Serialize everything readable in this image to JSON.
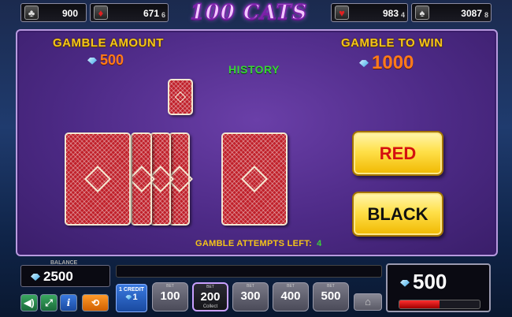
{
  "jackpots": [
    {
      "suit": "clubs",
      "symbol": "♣",
      "value": "900",
      "sub": ""
    },
    {
      "suit": "diamonds",
      "symbol": "♦",
      "value": "671",
      "sub": "6"
    },
    {
      "suit": "hearts",
      "symbol": "♥",
      "value": "983",
      "sub": "4"
    },
    {
      "suit": "spades",
      "symbol": "♠",
      "value": "3087",
      "sub": "8"
    }
  ],
  "logo": "100 CATS",
  "gamble": {
    "amount_label": "GAMBLE AMOUNT",
    "amount_value": "500",
    "to_win_label": "GAMBLE TO WIN",
    "to_win_value": "1000",
    "history_label": "HISTORY",
    "red_label": "RED",
    "black_label": "BLACK",
    "attempts_label": "GAMBLE ATTEMPTS LEFT:",
    "attempts_value": "4"
  },
  "bottom": {
    "balance_label": "BALANCE",
    "balance_value": "2500",
    "credit_label": "1 CREDIT",
    "credit_value": "1",
    "bet_label": "BET",
    "bets": [
      "100",
      "200",
      "300",
      "400",
      "500"
    ],
    "selected_bet": "200",
    "collect_label": "Collect",
    "win_value": "500",
    "win_meter_fraction": 0.5
  },
  "colors": {
    "accent_gold": "#f5c518",
    "amount_orange": "#ff7a1a",
    "history_green": "#3ad03a",
    "panel_purple": "#4d2a86",
    "card_red": "#c0202a"
  },
  "icons": {
    "gem": "diamond-gem-icon",
    "sound": "speaker-icon",
    "fullscreen": "expand-icon",
    "info": "info-icon",
    "autoplay": "repeat-icon",
    "home": "home-icon"
  }
}
